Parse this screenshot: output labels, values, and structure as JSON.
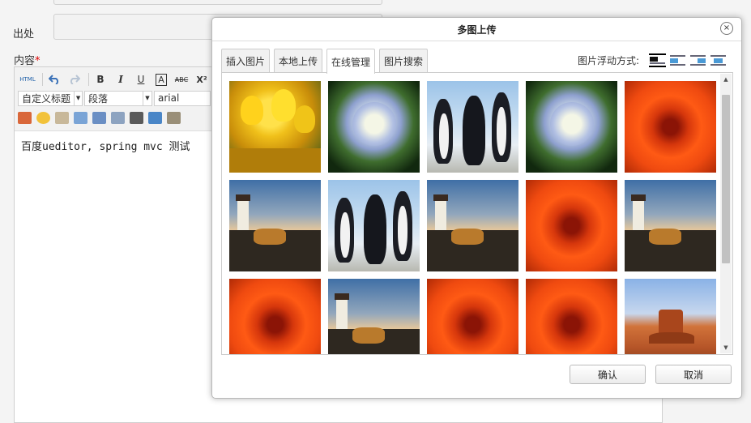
{
  "form": {
    "source_label": "出处",
    "content_label": "内容",
    "required_mark": "*"
  },
  "editor": {
    "toolbar": {
      "html_label": "HTML",
      "undo_icon": "undo-icon",
      "redo_icon": "redo-icon",
      "bold": "B",
      "italic": "I",
      "underline": "U",
      "fontborder": "A",
      "strikethrough": "ABC",
      "superscript": "X²",
      "heading_select": "自定义标题",
      "paragraph_select": "段落",
      "font_select": "arial"
    },
    "content_text": "百度ueditor, spring mvc 测试"
  },
  "dialog": {
    "title": "多图上传",
    "close_symbol": "×",
    "tabs": [
      "插入图片",
      "本地上传",
      "在线管理",
      "图片搜索"
    ],
    "active_tab_index": 2,
    "float_label": "图片浮动方式:",
    "float_options": [
      "none",
      "left",
      "right",
      "center"
    ],
    "selected_float": "none",
    "images": [
      [
        "tulips",
        "hydrangea",
        "penguins",
        "hydrangea",
        "chrysanthemum"
      ],
      [
        "lighthouse",
        "penguins",
        "lighthouse",
        "chrysanthemum",
        "lighthouse"
      ],
      [
        "chrysanthemum",
        "lighthouse",
        "chrysanthemum",
        "chrysanthemum",
        "desert"
      ]
    ],
    "confirm_label": "确认",
    "cancel_label": "取消"
  },
  "colors": {
    "page_background": "#f4f4f4",
    "required": "#dd0000",
    "link_blue": "#1d5fa8"
  }
}
